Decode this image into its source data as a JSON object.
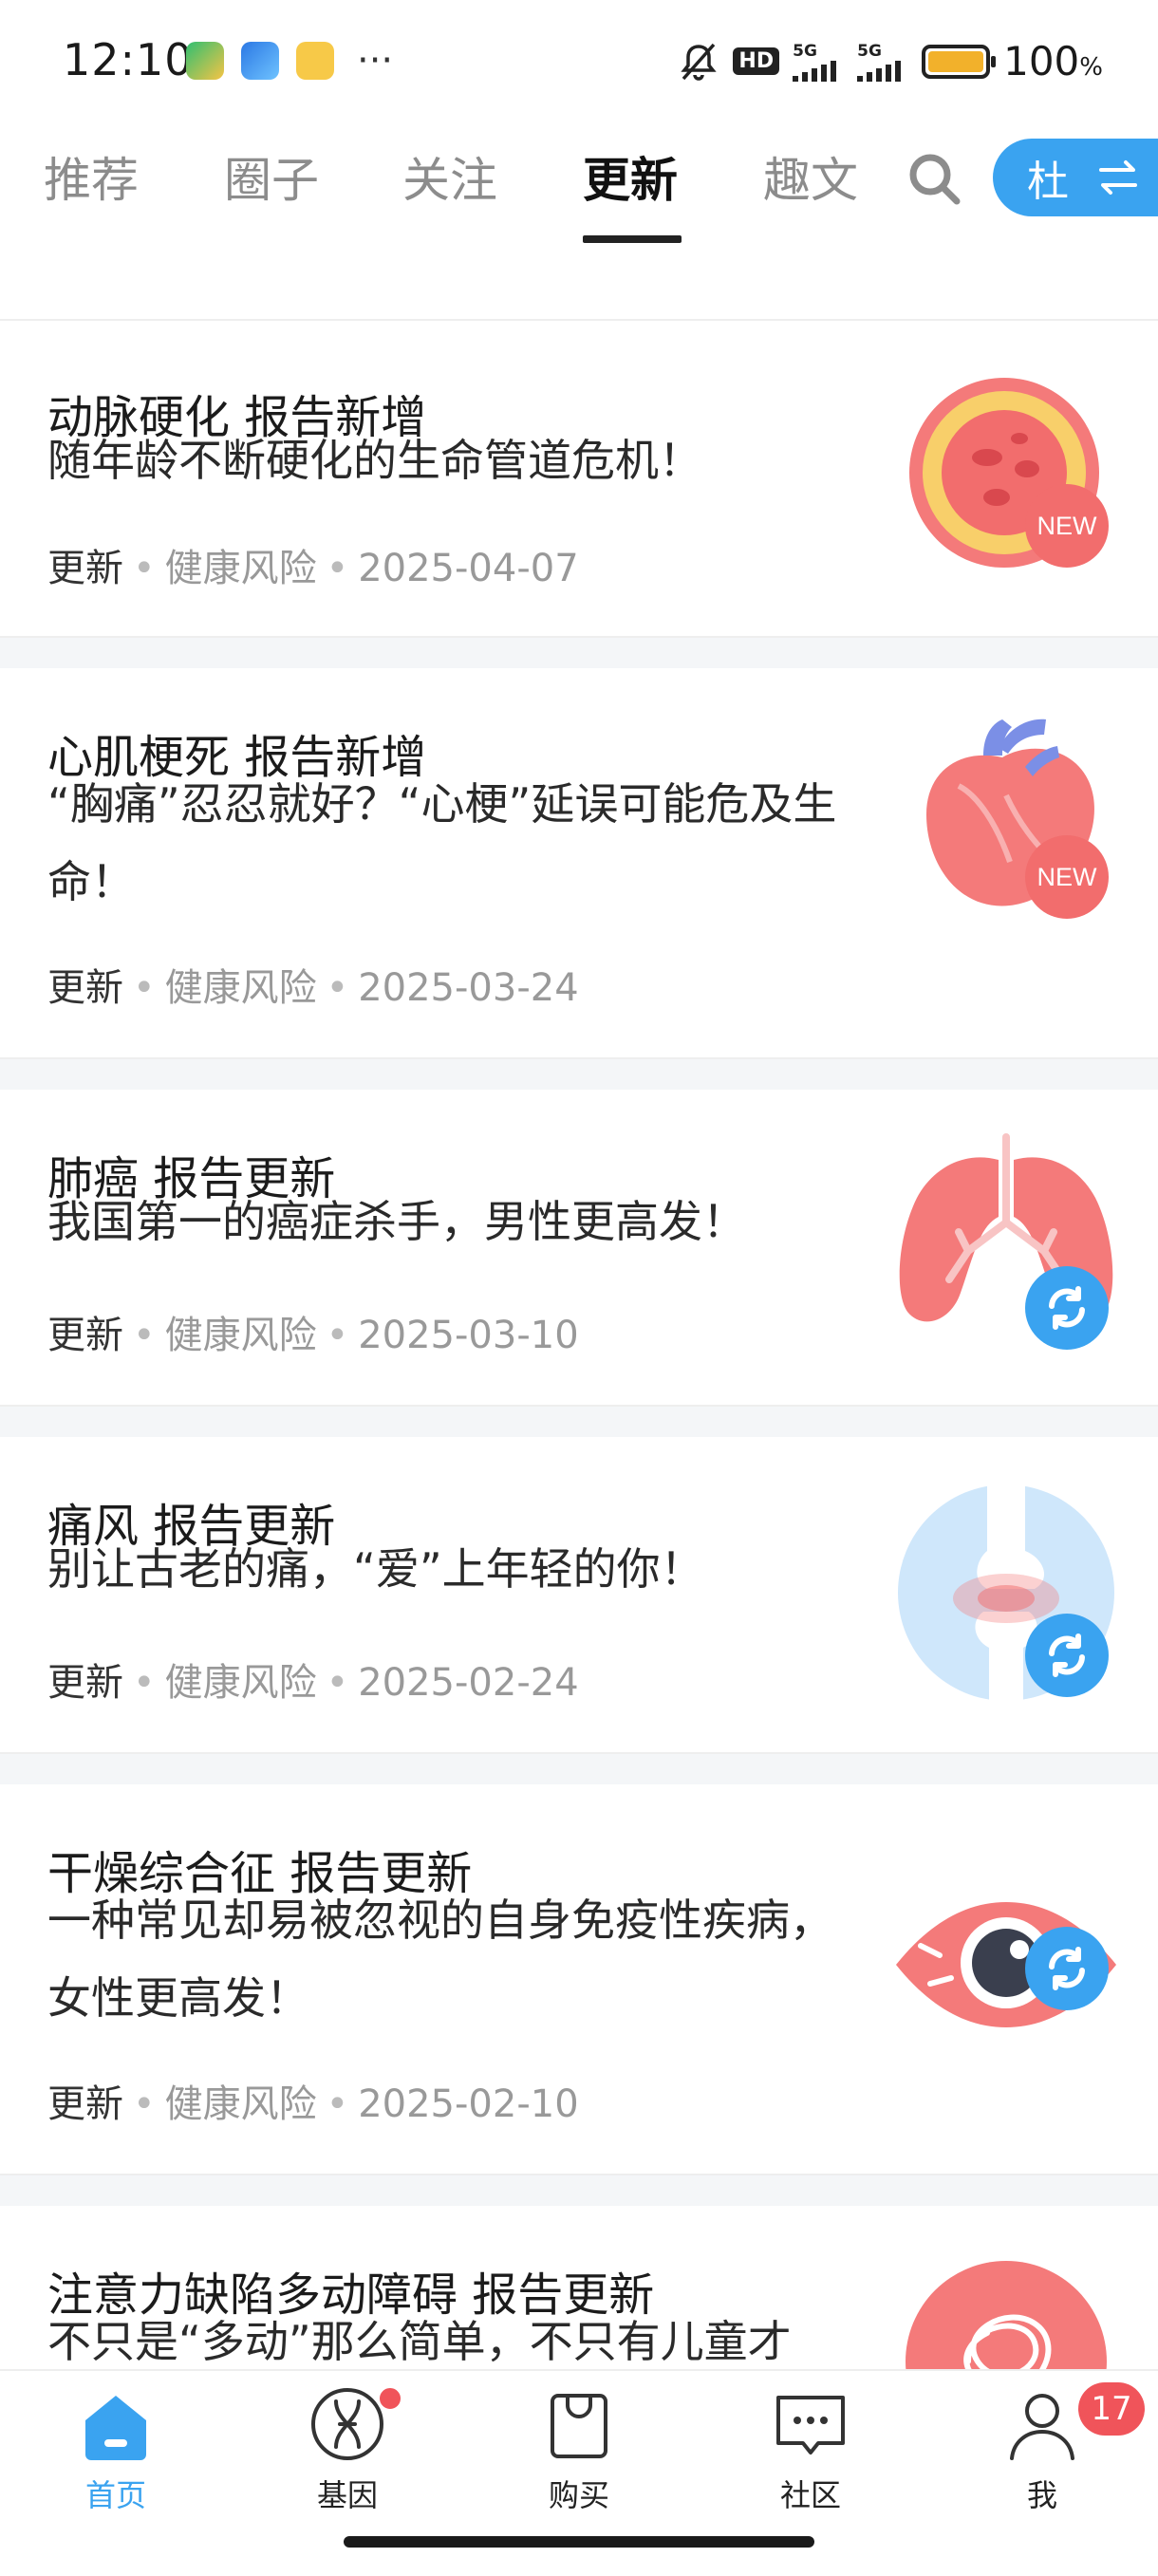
{
  "status_bar": {
    "time": "12:10",
    "more": "···",
    "hd_badge": "HD",
    "signal1": "5G",
    "signal2": "5G",
    "battery_percent": "100",
    "battery_unit": "%"
  },
  "tabs": [
    {
      "label": "推荐"
    },
    {
      "label": "圈子"
    },
    {
      "label": "关注"
    },
    {
      "label": "更新",
      "active": true
    },
    {
      "label": "趣文"
    }
  ],
  "header": {
    "profile_name": "杜",
    "accent_color": "#3aa3f0"
  },
  "feed": [
    {
      "title": "动脉硬化 报告新增",
      "desc": "随年龄不断硬化的生命管道危机！",
      "meta_type": "更新",
      "meta_category": "健康风险",
      "meta_date": "2025-04-07",
      "badge": "NEW",
      "icon": "artery-icon"
    },
    {
      "title": "心肌梗死 报告新增",
      "desc": "“胸痛”忍忍就好？“心梗”延误可能危及生命！",
      "meta_type": "更新",
      "meta_category": "健康风险",
      "meta_date": "2025-03-24",
      "badge": "NEW",
      "icon": "heart-icon"
    },
    {
      "title": "肺癌 报告更新",
      "desc": "我国第一的癌症杀手，男性更高发！",
      "meta_type": "更新",
      "meta_category": "健康风险",
      "meta_date": "2025-03-10",
      "badge": "refresh",
      "icon": "lungs-icon"
    },
    {
      "title": "痛风 报告更新",
      "desc": "别让古老的痛，“爱”上年轻的你！",
      "meta_type": "更新",
      "meta_category": "健康风险",
      "meta_date": "2025-02-24",
      "badge": "refresh",
      "icon": "joint-icon"
    },
    {
      "title": "干燥综合征 报告更新",
      "desc": "一种常见却易被忽视的自身免疫性疾病，女性更高发！",
      "meta_type": "更新",
      "meta_category": "健康风险",
      "meta_date": "2025-02-10",
      "badge": "refresh",
      "icon": "eye-icon"
    },
    {
      "title": "注意力缺陷多动障碍 报告更新",
      "desc": "不只是“多动”那么简单，不只有儿童才",
      "icon": "brain-tangle-icon"
    }
  ],
  "bottom_nav": [
    {
      "label": "首页",
      "icon": "home-icon",
      "active": true
    },
    {
      "label": "基因",
      "icon": "dna-icon"
    },
    {
      "label": "购买",
      "icon": "shopping-bag-icon"
    },
    {
      "label": "社区",
      "icon": "chat-icon"
    },
    {
      "label": "我",
      "icon": "user-icon"
    }
  ],
  "notifications": {
    "me_badge_count": "17"
  }
}
